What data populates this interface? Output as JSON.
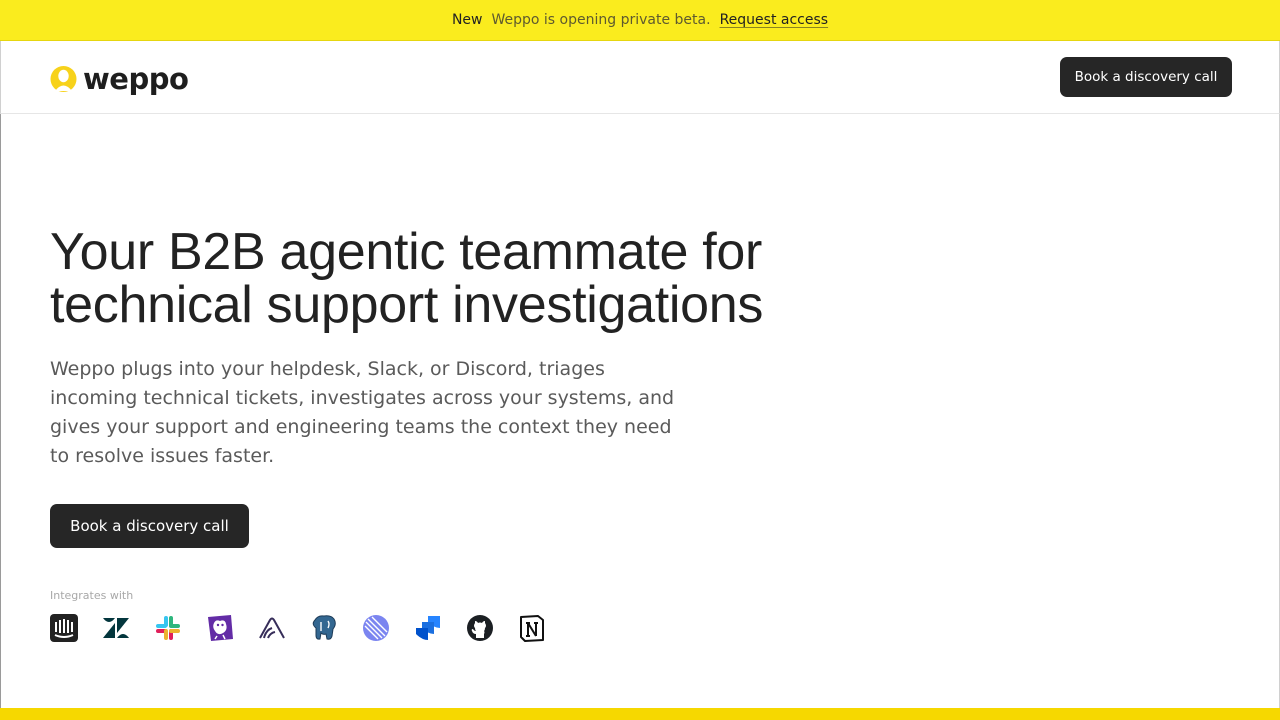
{
  "banner": {
    "new_label": "New",
    "message": "Weppo is opening private beta.",
    "link_label": "Request access"
  },
  "header": {
    "logo_text": "weppo",
    "cta_label": "Book a discovery call"
  },
  "hero": {
    "title_line1": "Your B2B agentic teammate for",
    "title_line2": "technical support investigations",
    "subtitle": "Weppo plugs into your helpdesk, Slack, or Discord, triages incoming technical tickets, investigates across your systems, and gives your support and engineering teams the context they need to resolve issues faster.",
    "cta_label": "Book a discovery call"
  },
  "integrations": {
    "label": "Integrates with",
    "icons": [
      "intercom-icon",
      "zendesk-icon",
      "slack-icon",
      "datadog-icon",
      "sentry-icon",
      "postgresql-icon",
      "linear-icon",
      "jira-icon",
      "github-icon",
      "notion-icon"
    ]
  },
  "colors": {
    "banner_bg": "#faec1e",
    "button_dark": "#262626",
    "accent_yellow": "#f6d800"
  }
}
